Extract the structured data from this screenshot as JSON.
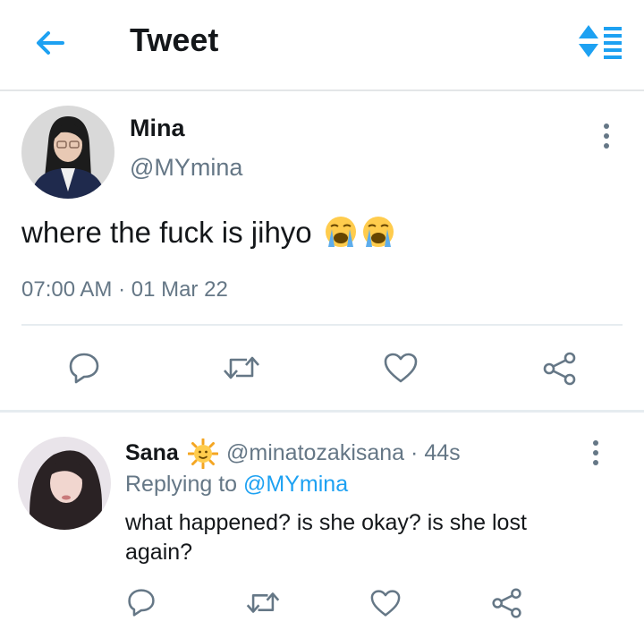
{
  "header": {
    "title": "Tweet",
    "back_icon": "arrow-left-icon",
    "sort_icon": "sort-list-icon",
    "accent_color": "#1da1f2"
  },
  "main_tweet": {
    "author_name": "Mina",
    "author_handle": "@MYmina",
    "text": "where the fuck is jihyo",
    "emojis": [
      "loudly-crying-face",
      "loudly-crying-face"
    ],
    "timestamp": "07:00 AM · 01 Mar 22",
    "actions": [
      "reply-icon",
      "retweet-icon",
      "like-icon",
      "share-icon"
    ]
  },
  "reply": {
    "author_name": "Sana",
    "badge_icon": "sun-with-face-emoji",
    "author_handle": "@minatozakisana",
    "time_ago": "· 44s",
    "replying_prefix": "Replying to",
    "replying_to": "@MYmina",
    "text": "what happened? is she okay? is she lost again?",
    "actions": [
      "reply-icon",
      "retweet-icon",
      "like-icon",
      "share-icon"
    ]
  },
  "colors": {
    "text_primary": "#14171a",
    "text_secondary": "#657786",
    "divider": "#e6ecf0"
  }
}
